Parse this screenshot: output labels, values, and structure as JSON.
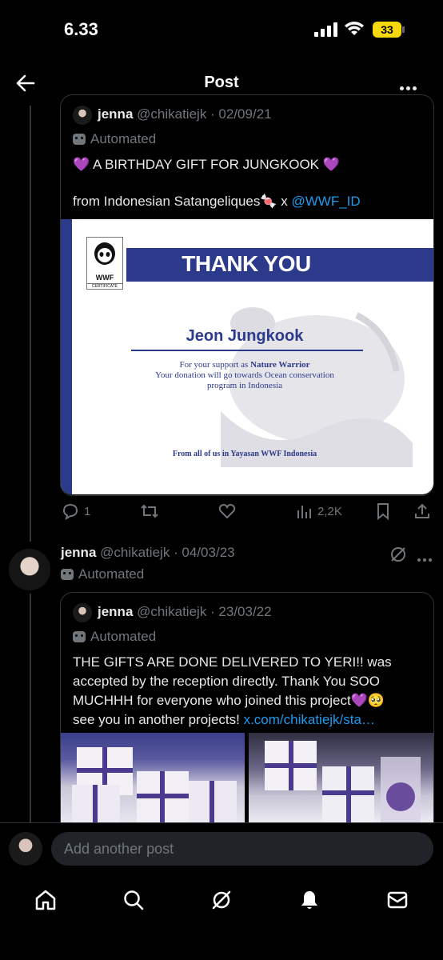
{
  "status_bar": {
    "time": "6.33",
    "battery": "33"
  },
  "header": {
    "title": "Post"
  },
  "quoted_post_1": {
    "name": "jenna",
    "handle_date": "@chikatiejk · 02/09/21",
    "automated": "Automated",
    "line1": "💜 A BIRTHDAY GIFT FOR JUNGKOOK 💜",
    "line2_prefix": "from Indonesian Satangeliques🍬 x ",
    "line2_link": "@WWF_ID",
    "certificate": {
      "logo_text": "WWF",
      "logo_sub": "CERTIFICATE",
      "thank_you": "THANK YOU",
      "recipient": "Jeon Jungkook",
      "support_prefix": "For your support as ",
      "support_role": "Nature Warrior",
      "line2": "Your donation will go towards Ocean conservation",
      "line3": "program in Indonesia",
      "from": "From all of us in Yayasan WWF Indonesia"
    }
  },
  "post_1_actions": {
    "replies": "1",
    "views": "2,2K"
  },
  "post_2": {
    "name": "jenna",
    "handle_date": "@chikatiejk · 04/03/23",
    "automated": "Automated"
  },
  "quoted_post_2": {
    "name": "jenna",
    "handle_date": "@chikatiejk · 23/03/22",
    "automated": "Automated",
    "line1": "THE GIFTS ARE DONE DELIVERED TO YERI!! was",
    "line2": "accepted by the reception directly. Thank You SOO",
    "line3": "MUCHHH for everyone who joined this project💜🥺",
    "line4_prefix": "see you in another projects! ",
    "line4_link": "x.com/chikatiejk/sta…"
  },
  "reply_box": {
    "placeholder": "Add another post"
  },
  "colors": {
    "accent": "#1d9bf0",
    "wwf_blue": "#2c3a8c",
    "background": "#000000"
  },
  "nav": [
    "home-icon",
    "search-icon",
    "grok-icon",
    "notifications-icon",
    "messages-icon"
  ]
}
